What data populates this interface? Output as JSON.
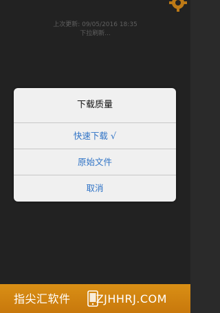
{
  "pull_refresh": {
    "last_update": "上次更新: 09/05/2016 18:35",
    "hint": "下拉刷新..."
  },
  "dialog": {
    "title": "下载质量",
    "options": [
      {
        "label": "快速下载",
        "selected": true,
        "check": "√"
      },
      {
        "label": "原始文件",
        "selected": false
      },
      {
        "label": "取消",
        "selected": false
      }
    ]
  },
  "watermark": {
    "left_text": "指尖汇软件",
    "right_text": "ZJHHRJ.COM"
  },
  "colors": {
    "background": "#272727",
    "option_text": "#2f73c6",
    "footer": "#d98f15"
  }
}
